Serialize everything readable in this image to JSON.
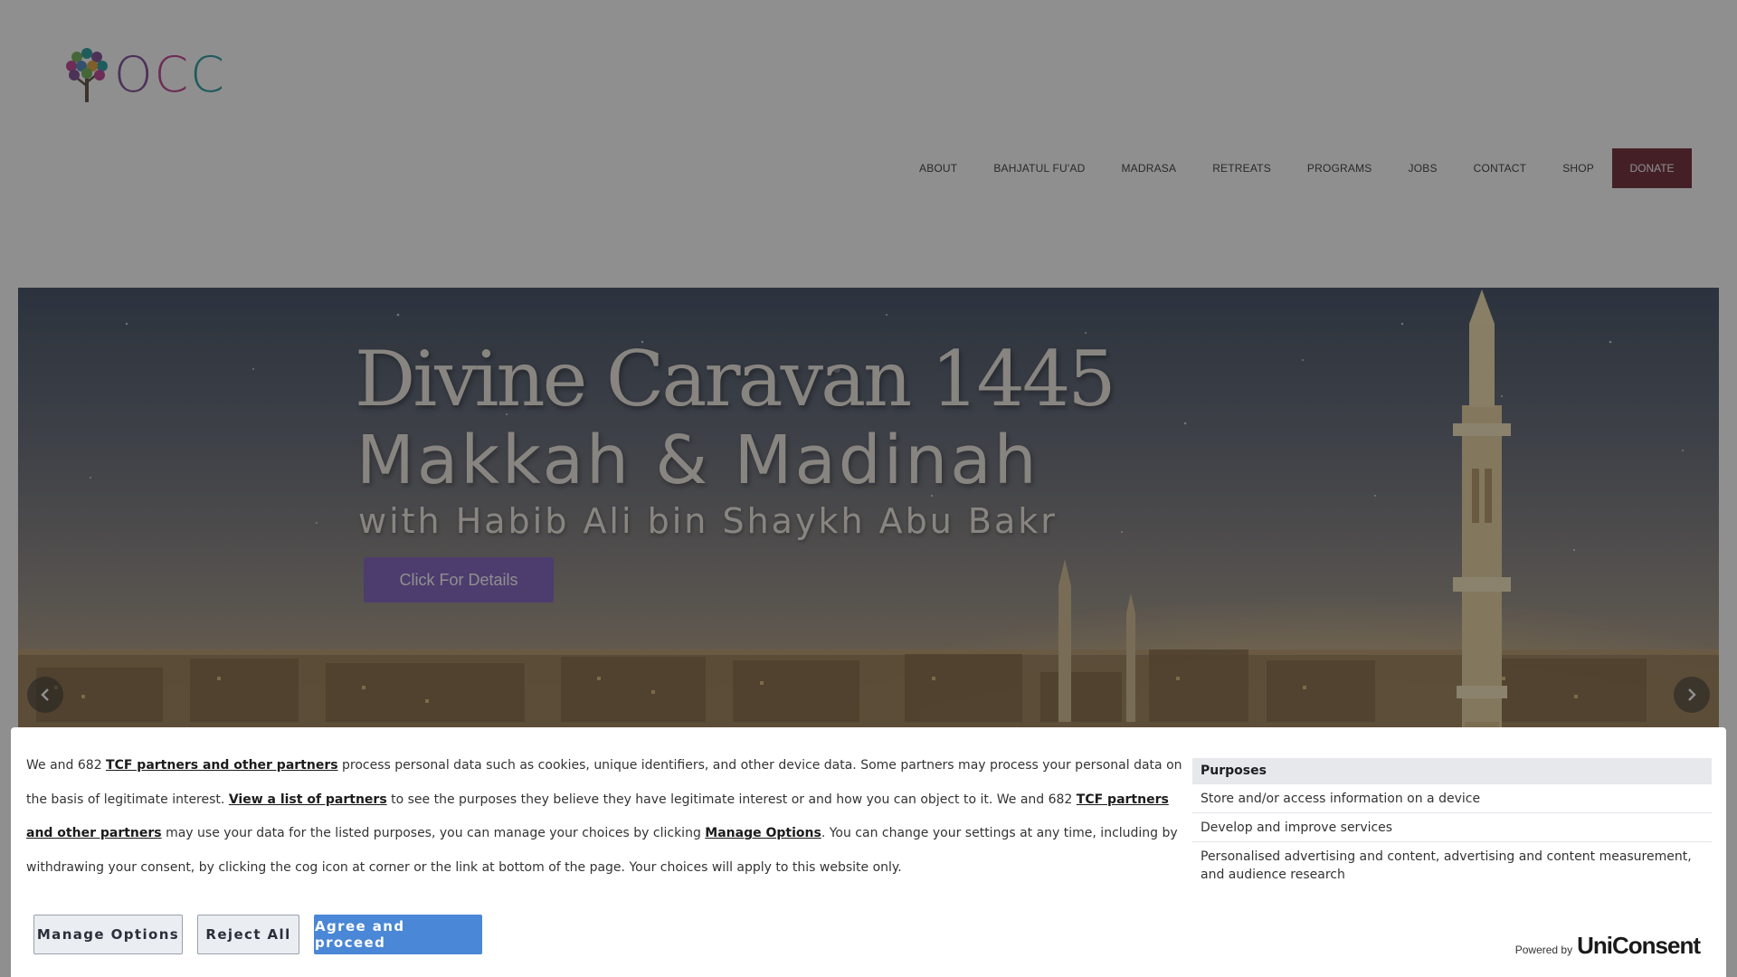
{
  "header": {
    "logo_text": "OCC",
    "nav": [
      {
        "label": "ABOUT"
      },
      {
        "label": "BAHJATUL FU'AD"
      },
      {
        "label": "MADRASA"
      },
      {
        "label": "RETREATS"
      },
      {
        "label": "PROGRAMS"
      },
      {
        "label": "JOBS"
      },
      {
        "label": "CONTACT"
      },
      {
        "label": "SHOP"
      }
    ],
    "donate_label": "DONATE",
    "colors": {
      "donate_bg": "#7a3a45",
      "logo_purple": "#8a5a9e",
      "logo_pink": "#c2509a",
      "logo_teal": "#3aa2a6"
    }
  },
  "hero": {
    "title_line1": "Divine Caravan 1445",
    "title_line2": "Makkah & Madinah",
    "subtitle": "with Habib Ali bin Shaykh Abu Bakr",
    "cta_label": "Click For Details",
    "prev_icon": "chevron-left-icon",
    "next_icon": "chevron-right-icon",
    "colors": {
      "cta_bg": "#8a6cc4"
    }
  },
  "consent": {
    "text": {
      "p1": "We and 682 ",
      "link1": "TCF partners and other partners",
      "p2": " process personal data such as cookies, unique identifiers, and other device data. Some partners may process your personal data on the basis of legitimate interest. ",
      "link2": "View a list of partners",
      "p3": " to see the purposes they believe they have legitimate interest or and how you can object to it. We and 682 ",
      "link3": "TCF partners and other partners",
      "p4": " may use your data for the listed purposes, you can manage your choices by clicking ",
      "link4": "Manage Options",
      "p5": ". You can change your settings at any time, including by withdrawing your consent, by clicking the cog icon at corner or the link at bottom of the page. Your choices will apply to this website only."
    },
    "buttons": {
      "manage": "Manage Options",
      "reject": "Reject All",
      "agree": "Agree and proceed"
    },
    "purposes": {
      "title": "Purposes",
      "items": [
        {
          "label": "Store and/or access information on a device"
        },
        {
          "label": "Develop and improve services"
        },
        {
          "label": "Personalised advertising and content, advertising and content measurement, and audience research"
        }
      ]
    },
    "powered_by": {
      "label": "Powered by",
      "brand": "UniConsent"
    },
    "colors": {
      "agree_bg": "#4a87d6"
    }
  }
}
